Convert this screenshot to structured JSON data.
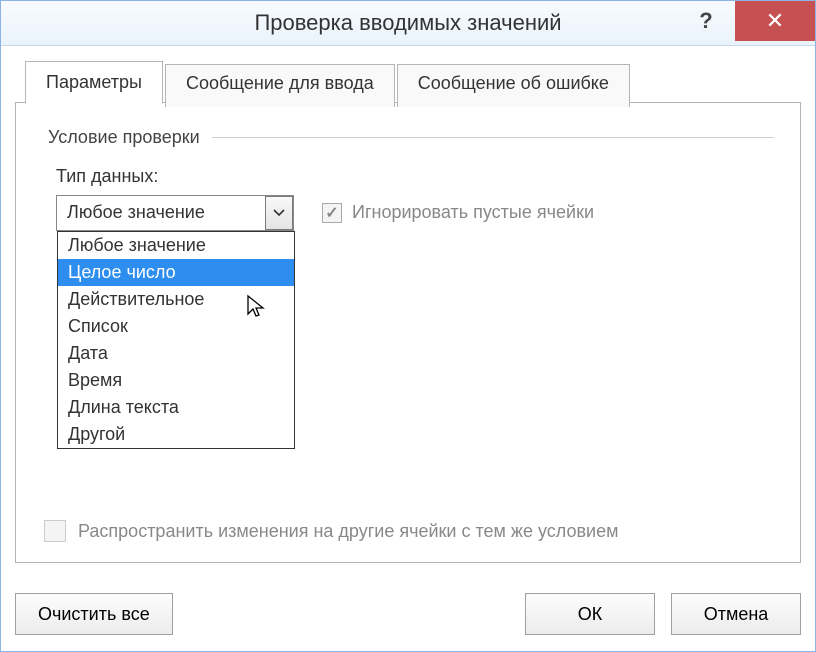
{
  "title": "Проверка вводимых значений",
  "titlebar": {
    "help_symbol": "?",
    "close_symbol": "✕"
  },
  "tabs": [
    {
      "label": "Параметры",
      "active": true
    },
    {
      "label": "Сообщение для ввода",
      "active": false
    },
    {
      "label": "Сообщение об ошибке",
      "active": false
    }
  ],
  "groupbox": {
    "title": "Условие проверки"
  },
  "data_type": {
    "label": "Тип данных:",
    "selected": "Любое значение",
    "highlighted_index": 1,
    "options": [
      "Любое значение",
      "Целое число",
      "Действительное",
      "Список",
      "Дата",
      "Время",
      "Длина текста",
      "Другой"
    ]
  },
  "ignore_blank": {
    "label": "Игнорировать пустые ячейки",
    "checked": true,
    "disabled": true
  },
  "propagate": {
    "label": "Распространить изменения на другие ячейки с тем же условием",
    "checked": false,
    "disabled": true
  },
  "buttons": {
    "clear_all": "Очистить все",
    "ok": "ОК",
    "cancel": "Отмена"
  }
}
